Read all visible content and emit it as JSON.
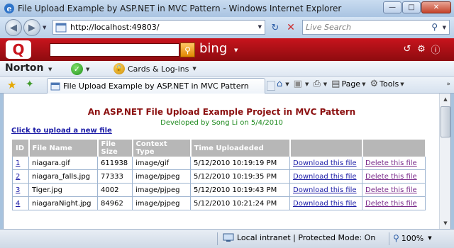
{
  "window": {
    "title": "File Upload Example by ASP.NET in MVC Pattern - Windows Internet Explorer",
    "icon": "ie-icon"
  },
  "address": {
    "url": "http://localhost:49803/",
    "search_placeholder": "Live Search"
  },
  "bing_toolbar": {
    "brand": "bing"
  },
  "norton_toolbar": {
    "brand": "Norton",
    "cards_label": "Cards & Log-ins"
  },
  "tab": {
    "label": "File Upload Example by ASP.NET in MVC Pattern"
  },
  "commands": {
    "page_label": "Page",
    "tools_label": "Tools"
  },
  "page": {
    "heading": "An ASP.NET File Upload Example Project in MVC Pattern",
    "subheading": "Developed by Song Li on 5/4/2010",
    "upload_link": "Click to upload a new file",
    "columns": [
      "ID",
      "File Name",
      "File Size",
      "Context Type",
      "Time Uploadeded",
      "",
      ""
    ],
    "rows": [
      {
        "id": "1",
        "name": "niagara.gif",
        "size": "611938",
        "type": "image/gif",
        "time": "5/12/2010 10:19:19 PM",
        "download": "Download this file",
        "delete": "Delete this file"
      },
      {
        "id": "2",
        "name": "niagara_falls.jpg",
        "size": "77333",
        "type": "image/pjpeg",
        "time": "5/12/2010 10:19:35 PM",
        "download": "Download this file",
        "delete": "Delete this file"
      },
      {
        "id": "3",
        "name": "Tiger.jpg",
        "size": "4002",
        "type": "image/pjpeg",
        "time": "5/12/2010 10:19:43 PM",
        "download": "Download this file",
        "delete": "Delete this file"
      },
      {
        "id": "4",
        "name": "niagaraNight.jpg",
        "size": "84962",
        "type": "image/pjpeg",
        "time": "5/12/2010 10:21:24 PM",
        "download": "Download this file",
        "delete": "Delete this file"
      }
    ]
  },
  "status": {
    "zone": "Local intranet | Protected Mode: On",
    "zoom": "100%"
  },
  "colors": {
    "heading": "#8b1010",
    "subheading": "#1f8a1f",
    "link": "#1a1aa6",
    "table_header_bg": "#b7b7b7",
    "bing_bar": "#c8141d"
  }
}
